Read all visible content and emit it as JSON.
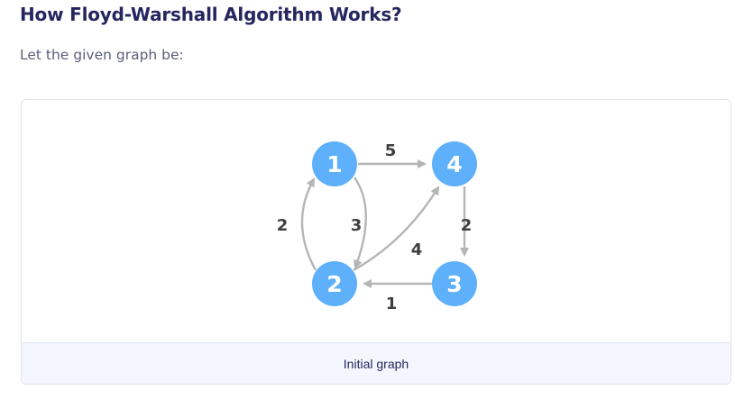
{
  "heading": "How Floyd-Warshall Algorithm Works?",
  "intro": "Let the given graph be:",
  "figure": {
    "caption": "Initial graph",
    "nodes": [
      {
        "id": "1",
        "label": "1"
      },
      {
        "id": "4",
        "label": "4"
      },
      {
        "id": "2",
        "label": "2"
      },
      {
        "id": "3",
        "label": "3"
      }
    ],
    "edges": [
      {
        "from": "1",
        "to": "4",
        "weight": "5"
      },
      {
        "from": "4",
        "to": "3",
        "weight": "2"
      },
      {
        "from": "3",
        "to": "2",
        "weight": "1"
      },
      {
        "from": "2",
        "to": "4",
        "weight": "4"
      },
      {
        "from": "1",
        "to": "2",
        "weight": "3"
      },
      {
        "from": "2",
        "to": "1",
        "weight": "2"
      }
    ]
  },
  "colors": {
    "node_fill": "#5eb0fb",
    "edge_stroke": "#b5b5b5",
    "weight_text": "#3f3f3f",
    "heading_text": "#25265e",
    "caption_bg": "#f3f7fd"
  }
}
